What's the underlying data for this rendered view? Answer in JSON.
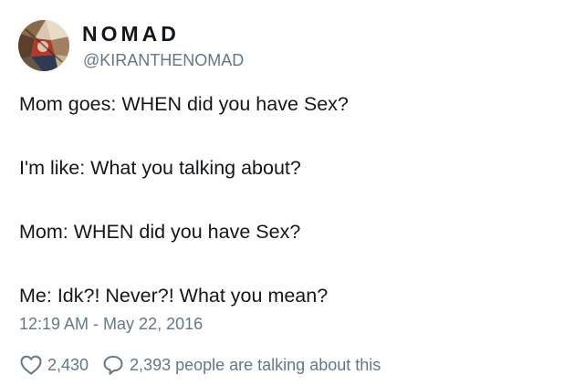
{
  "author": {
    "display_name": "NOMAD",
    "handle": "@KIRANTHENOMAD",
    "avatar_icon": "profile-photo"
  },
  "body": {
    "lines": [
      "Mom goes: WHEN did you have Sex?",
      "I'm like: What you talking about?",
      "Mom: WHEN did you have Sex?",
      "Me: Idk?! Never?! What you mean?"
    ]
  },
  "timestamp": "12:19 AM - May 22, 2016",
  "actions": {
    "like_icon": "heart-icon",
    "like_count": "2,430",
    "reply_icon": "speech-bubble-icon",
    "talking_text": "2,393 people are talking about this"
  },
  "colors": {
    "text": "#14171a",
    "secondary": "#657786"
  }
}
